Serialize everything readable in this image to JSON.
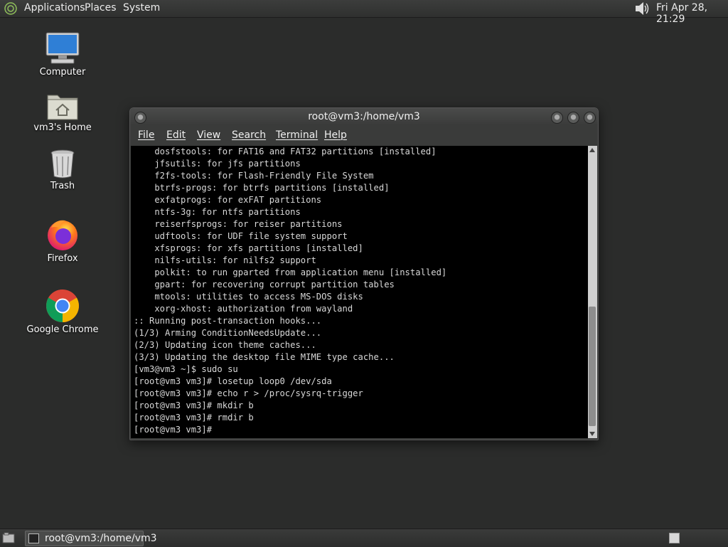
{
  "top_panel": {
    "menus": [
      "Applications",
      "Places",
      "System"
    ],
    "clock": "Fri Apr 28, 21:29"
  },
  "desktop": {
    "icons": [
      {
        "label": "Computer",
        "icon": "computer-icon"
      },
      {
        "label": "vm3's Home",
        "icon": "home-folder-icon"
      },
      {
        "label": "Trash",
        "icon": "trash-icon"
      },
      {
        "label": "Firefox",
        "icon": "firefox-icon"
      },
      {
        "label": "Google Chrome",
        "icon": "chrome-icon"
      }
    ]
  },
  "terminal": {
    "title": "root@vm3:/home/vm3",
    "menu": [
      "File",
      "Edit",
      "View",
      "Search",
      "Terminal",
      "Help"
    ],
    "output": "    dosfstools: for FAT16 and FAT32 partitions [installed]\n    jfsutils: for jfs partitions\n    f2fs-tools: for Flash-Friendly File System\n    btrfs-progs: for btrfs partitions [installed]\n    exfatprogs: for exFAT partitions\n    ntfs-3g: for ntfs partitions\n    reiserfsprogs: for reiser partitions\n    udftools: for UDF file system support\n    xfsprogs: for xfs partitions [installed]\n    nilfs-utils: for nilfs2 support\n    polkit: to run gparted from application menu [installed]\n    gpart: for recovering corrupt partition tables\n    mtools: utilities to access MS-DOS disks\n    xorg-xhost: authorization from wayland\n:: Running post-transaction hooks...\n(1/3) Arming ConditionNeedsUpdate...\n(2/3) Updating icon theme caches...\n(3/3) Updating the desktop file MIME type cache...\n[vm3@vm3 ~]$ sudo su\n[root@vm3 vm3]# losetup loop0 /dev/sda\n[root@vm3 vm3]# echo r > /proc/sysrq-trigger\n[root@vm3 vm3]# mkdir b\n[root@vm3 vm3]# rmdir b\n[root@vm3 vm3]# "
  },
  "taskbar": {
    "task_label": "root@vm3:/home/vm3"
  },
  "colors": {
    "desktop_bg": "#2b2c2b",
    "terminal_bg": "#000000",
    "terminal_fg": "#d8d8d8"
  }
}
